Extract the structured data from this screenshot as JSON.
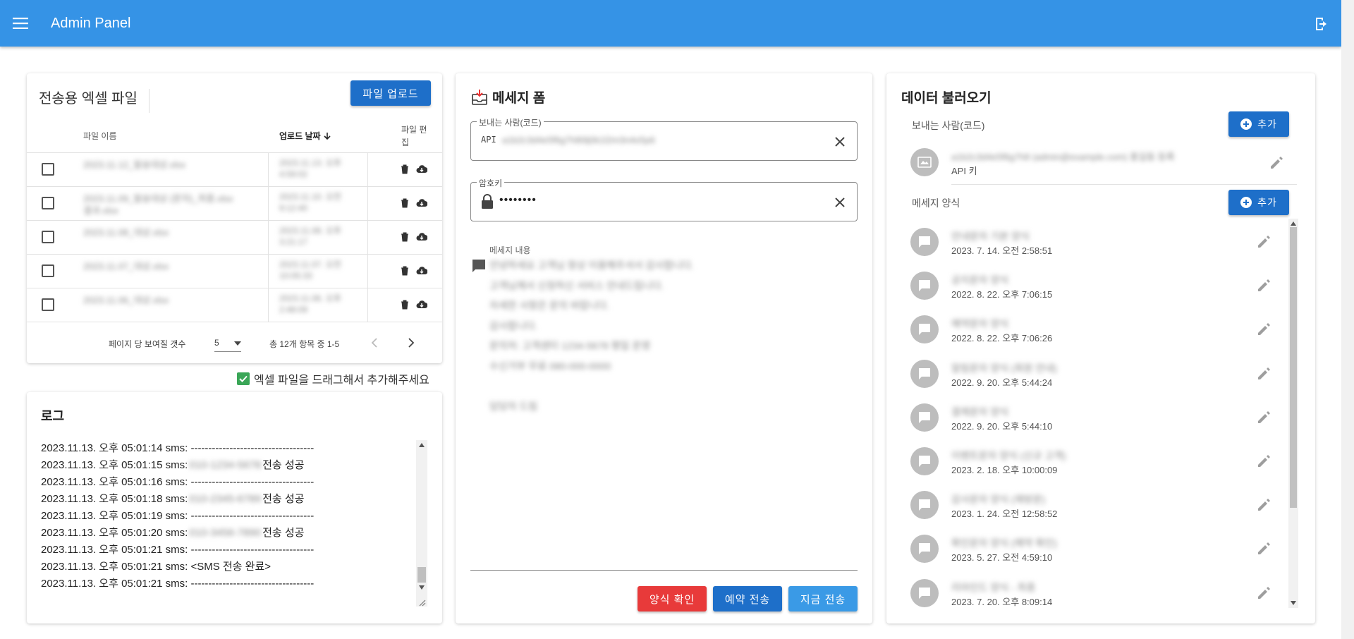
{
  "appbar": {
    "title": "Admin Panel"
  },
  "files": {
    "title": "전송용 엑셀 파일",
    "upload_label": "파일 업로드",
    "col_name": "파일 이름",
    "col_date": "업로드 날짜",
    "col_edit_1": "파일 편",
    "col_edit_2": "집",
    "rows": [
      {
        "name_1": "2023.11.12_발송대상.xlsx",
        "name_2": "",
        "date_1": "2023.11.13. 오후",
        "date_2": "4:59:02"
      },
      {
        "name_1": "2023.11.09_발송대상 (문자)_최종.xlsx",
        "name_2": "결과.xlsx",
        "date_1": "2023.11.10. 오전",
        "date_2": "9:12:40"
      },
      {
        "name_1": "2023.11.08_대상.xlsx",
        "name_2": "",
        "date_1": "2023.11.08. 오후",
        "date_2": "3:21:17"
      },
      {
        "name_1": "2023.11.07_대상.xlsx",
        "name_2": "",
        "date_1": "2023.11.07. 오전",
        "date_2": "10:05:33"
      },
      {
        "name_1": "2023.11.06_대상.xlsx",
        "name_2": "",
        "date_1": "2023.11.06. 오후",
        "date_2": "2:48:09"
      }
    ],
    "pager": {
      "rows_per_page_label": "페이지 당 보여질 갯수",
      "rows_per_page": "5",
      "range_text": "총 12개 항목 중 1-5"
    }
  },
  "hint": {
    "text": "엑셀 파일을 드래그해서 추가해주세요"
  },
  "log": {
    "title": "로그",
    "lines": [
      {
        "prefix": "2023.11.13. 오후 05:01:14 sms: -----------------------------------",
        "hidden": "",
        "suffix": ""
      },
      {
        "prefix": "2023.11.13. 오후 05:01:15 sms:",
        "hidden": "010-1234-5678",
        "suffix": "전송 성공"
      },
      {
        "prefix": "2023.11.13. 오후 05:01:16 sms: -----------------------------------",
        "hidden": "",
        "suffix": ""
      },
      {
        "prefix": "2023.11.13. 오후 05:01:18 sms:",
        "hidden": "010-2345-6789",
        "suffix": "전송 성공"
      },
      {
        "prefix": "2023.11.13. 오후 05:01:19 sms: -----------------------------------",
        "hidden": "",
        "suffix": ""
      },
      {
        "prefix": "2023.11.13. 오후 05:01:20 sms:",
        "hidden": "010-3456-7890",
        "suffix": "전송 성공"
      },
      {
        "prefix": "2023.11.13. 오후 05:01:21 sms: -----------------------------------",
        "hidden": "",
        "suffix": ""
      },
      {
        "prefix": "2023.11.13. 오후 05:01:21 sms: <SMS 전송 완료>",
        "hidden": "",
        "suffix": ""
      },
      {
        "prefix": "2023.11.13. 오후 05:01:21 sms: -----------------------------------",
        "hidden": "",
        "suffix": ""
      }
    ]
  },
  "form": {
    "title": "메세지 폼",
    "sender_label": "보내는 사람(코드)",
    "sender_prefix": "API",
    "sender_value": "a1b2c3d4e5f6g7h8i9j0k1l2m3n4o5p6",
    "password_label": "암호키",
    "password_value": "••••••••",
    "message_label": "메세지 내용",
    "message_lines": [
      "안녕하세요 고객님 항상 이용해주셔서 감사합니다.",
      "고객님께서 신청하신 서비스 안내드립니다.",
      "자세한 사항은 문의 바랍니다.",
      "감사합니다.",
      "문의처: 고객센터 1234-5678 평일 운영",
      "수신거부 무료 080-000-0000",
      "",
      "담당자 드림"
    ],
    "btn_check": "양식 확인",
    "btn_reserve": "예약 전송",
    "btn_now": "지금 전송"
  },
  "data": {
    "title": "데이터 불러오기",
    "sender_section": "보내는 사람(코드)",
    "add_label": "추가",
    "sender_item": {
      "title": "a1b2c3d4e5f6g7h8 (admin@example.com) 홍길동 등록",
      "sub": "API 키"
    },
    "template_section": "메세지 양식",
    "templates": [
      {
        "title": "안내문자 기본 양식",
        "date": "2023. 7. 14. 오전 2:58:51"
      },
      {
        "title": "공지문자 양식",
        "date": "2022. 8. 22. 오후 7:06:15"
      },
      {
        "title": "예약문자 양식",
        "date": "2022. 8. 22. 오후 7:06:26"
      },
      {
        "title": "알림문자 양식 (회원 안내)",
        "date": "2022. 9. 20. 오후 5:44:24"
      },
      {
        "title": "결제문자 양식",
        "date": "2022. 9. 20. 오후 5:44:10"
      },
      {
        "title": "이벤트문자 양식 (신규 고객)",
        "date": "2023. 2. 18. 오후 10:00:09"
      },
      {
        "title": "감사문자 양식 (재방문)",
        "date": "2023. 1. 24. 오전 12:58:52"
      },
      {
        "title": "확인문자 양식 (예약 확인)",
        "date": "2023. 5. 27. 오전 4:59:10"
      },
      {
        "title": "리마인드 양식 - 최종",
        "date": "2023. 7. 20. 오후 8:09:14"
      }
    ]
  }
}
